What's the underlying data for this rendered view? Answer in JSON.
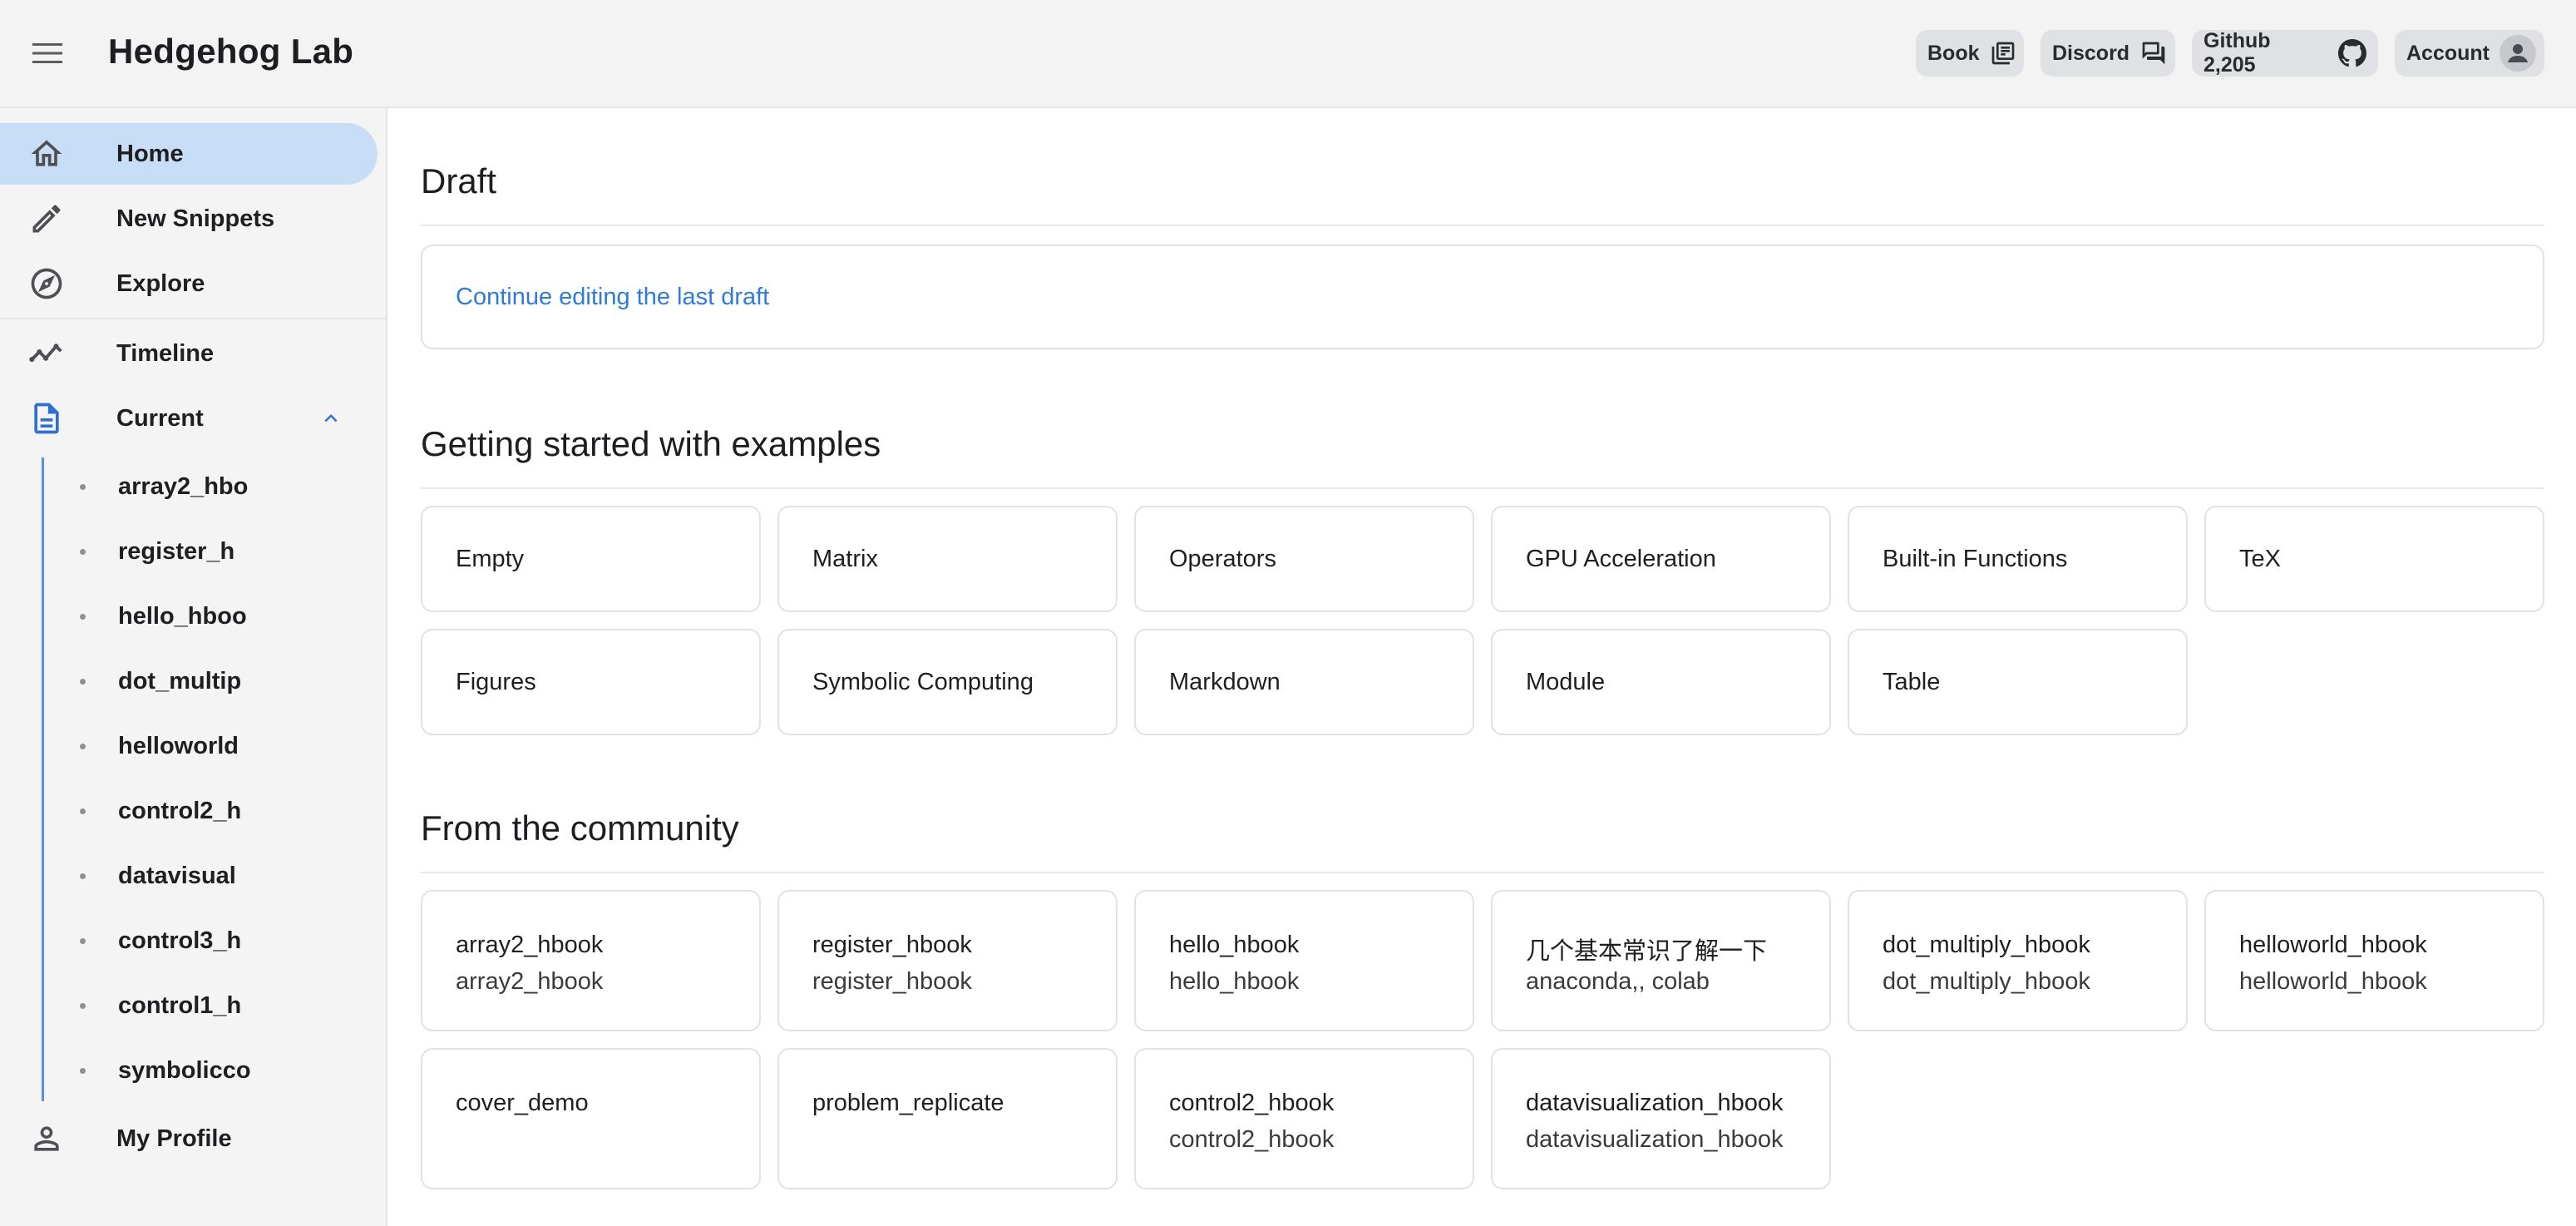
{
  "header": {
    "title": "Hedgehog Lab",
    "buttons": {
      "book": "Book",
      "discord": "Discord",
      "github": "Github 2,205",
      "account": "Account"
    }
  },
  "sidebar": {
    "items": [
      {
        "label": "Home",
        "icon": "home-icon",
        "active": true
      },
      {
        "label": "New Snippets",
        "icon": "pencil-icon"
      },
      {
        "label": "Explore",
        "icon": "compass-icon"
      },
      {
        "label": "Timeline",
        "icon": "timeline-icon"
      },
      {
        "label": "Current",
        "icon": "document-icon",
        "expanded": true
      },
      {
        "label": "My Profile",
        "icon": "person-icon"
      }
    ],
    "current_children": [
      "array2_hbo",
      "register_h",
      "hello_hboo",
      "dot_multip",
      "helloworld",
      "control2_h",
      "datavisual",
      "control3_h",
      "control1_h",
      "symbolicco"
    ]
  },
  "main": {
    "draft": {
      "title": "Draft",
      "link": "Continue editing the last draft"
    },
    "examples": {
      "title": "Getting started with examples",
      "items": [
        "Empty",
        "Matrix",
        "Operators",
        "GPU Acceleration",
        "Built-in Functions",
        "TeX",
        "Figures",
        "Symbolic Computing",
        "Markdown",
        "Module",
        "Table"
      ]
    },
    "community": {
      "title": "From the community",
      "items": [
        {
          "title": "array2_hbook",
          "subtitle": "array2_hbook"
        },
        {
          "title": "register_hbook",
          "subtitle": "register_hbook"
        },
        {
          "title": "hello_hbook",
          "subtitle": "hello_hbook"
        },
        {
          "title": "几个基本常识了解一下",
          "subtitle": "anaconda,, colab"
        },
        {
          "title": "dot_multiply_hbook",
          "subtitle": "dot_multiply_hbook"
        },
        {
          "title": "helloworld_hbook",
          "subtitle": "helloworld_hbook"
        },
        {
          "title": "cover_demo",
          "subtitle": ""
        },
        {
          "title": "problem_replicate",
          "subtitle": ""
        },
        {
          "title": "control2_hbook",
          "subtitle": "control2_hbook"
        },
        {
          "title": "datavisualization_hbook",
          "subtitle": "datavisualization_hbook"
        }
      ]
    }
  },
  "colors": {
    "accent": "#2f7bd6",
    "active_nav": "#c7def6",
    "tree_line": "#5a8ee0"
  }
}
